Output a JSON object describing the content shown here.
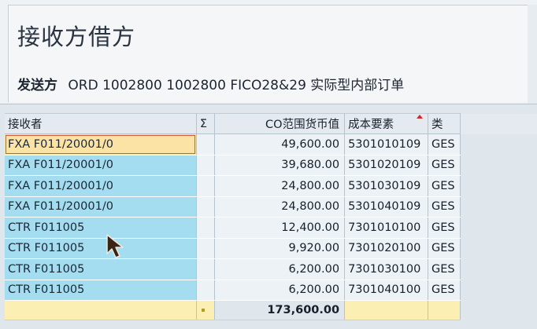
{
  "header": {
    "title": "接收方借方",
    "sender_label": "发送方",
    "sender_value": "ORD 1002800 1002800 FICO28&29 实际型内部订单"
  },
  "grid": {
    "columns": {
      "receiver": "接收者",
      "sigma": "Σ",
      "value": "CO范围货币值",
      "cost_element": "成本要素",
      "type": "类"
    },
    "sort_column": "cost_element",
    "rows": [
      {
        "receiver": "FXA F011/20001/0",
        "value": "49,600.00",
        "cost_element": "5301010109",
        "type": "GES"
      },
      {
        "receiver": "FXA F011/20001/0",
        "value": "39,680.00",
        "cost_element": "5301020109",
        "type": "GES"
      },
      {
        "receiver": "FXA F011/20001/0",
        "value": "24,800.00",
        "cost_element": "5301030109",
        "type": "GES"
      },
      {
        "receiver": "FXA F011/20001/0",
        "value": "24,800.00",
        "cost_element": "5301040109",
        "type": "GES"
      },
      {
        "receiver": "CTR F011005",
        "value": "12,400.00",
        "cost_element": "7301010100",
        "type": "GES"
      },
      {
        "receiver": "CTR F011005",
        "value": "9,920.00",
        "cost_element": "7301020100",
        "type": "GES"
      },
      {
        "receiver": "CTR F011005",
        "value": "6,200.00",
        "cost_element": "7301030100",
        "type": "GES"
      },
      {
        "receiver": "CTR F011005",
        "value": "6,200.00",
        "cost_element": "7301040100",
        "type": "GES"
      }
    ],
    "total": "173,600.00",
    "selected_row": 0
  },
  "colors": {
    "receiver_cell": "#a4dcf0",
    "total_row": "#fbefb4",
    "selected_cell": "#fbe3a6",
    "sort_indicator": "#d2262b"
  },
  "icons": {
    "sort": "sort-ascending-icon",
    "total_marker": "total-marker-icon",
    "cursor": "mouse-pointer-icon"
  }
}
